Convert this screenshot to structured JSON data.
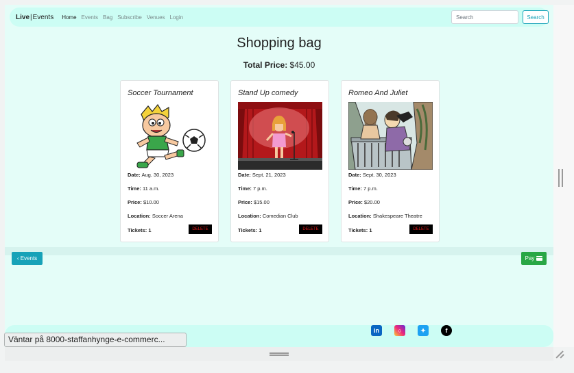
{
  "nav": {
    "brand_bold": "Live",
    "brand_sep": "|",
    "brand_rest": "Events",
    "links": [
      "Home",
      "Events",
      "Bag",
      "Subscribe",
      "Venues",
      "Login"
    ],
    "search_placeholder": "Search",
    "search_button": "Search"
  },
  "main": {
    "title": "Shopping bag",
    "total_label": "Total Price:",
    "total_value": "$45.00"
  },
  "labels": {
    "date": "Date:",
    "time": "Time:",
    "price": "Price:",
    "location": "Location:",
    "tickets": "Tickets:",
    "delete": "DELETE"
  },
  "cards": [
    {
      "title": "Soccer Tournament",
      "date": "Aug. 30, 2023",
      "time": "11 a.m.",
      "price": "$10.00",
      "location": "Soccer Arena",
      "tickets": "1"
    },
    {
      "title": "Stand Up comedy",
      "date": "Sept. 21, 2023",
      "time": "7 p.m.",
      "price": "$15.00",
      "location": "Comedian Club",
      "tickets": "1"
    },
    {
      "title": "Romeo And Juliet",
      "date": "Sept. 30, 2023",
      "time": "7 p.m.",
      "price": "$20.00",
      "location": "Shakespeare Theatre",
      "tickets": "1"
    }
  ],
  "actions": {
    "back_label": "Events",
    "pay_label": "Pay"
  },
  "footer": {
    "social_icons": [
      "linkedin-icon",
      "instagram-icon",
      "twitter-icon",
      "facebook-icon"
    ]
  },
  "status": {
    "text": "Väntar på 8000-staffanhynge-e-commerc..."
  },
  "colors": {
    "background": "#e4fdf8",
    "navbar": "#ccfdf4",
    "info": "#17a2b8",
    "success": "#28a745"
  }
}
